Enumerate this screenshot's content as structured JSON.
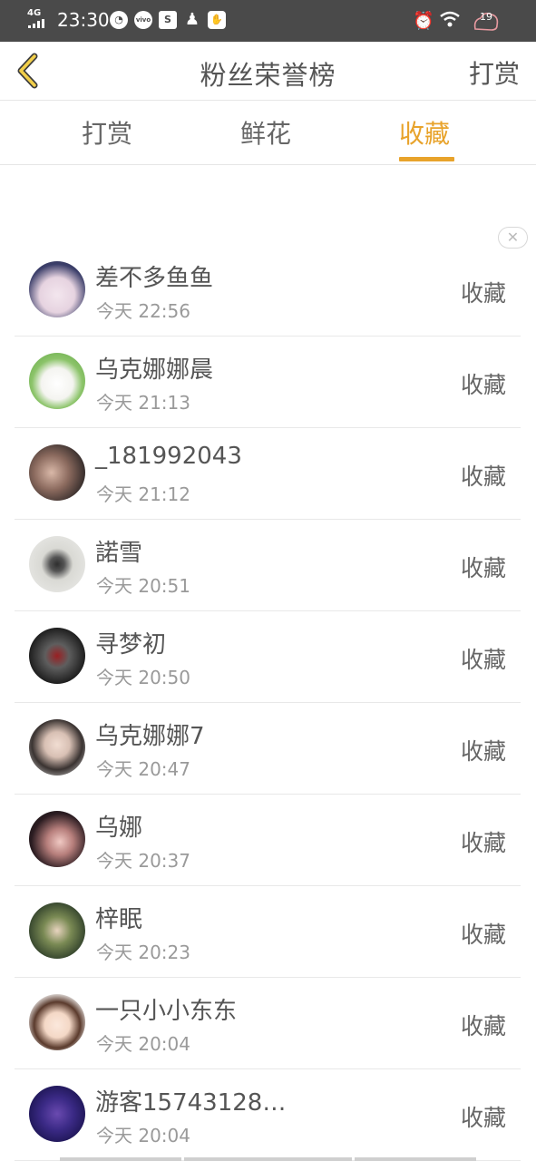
{
  "status_bar": {
    "network": "4G",
    "time": "23:30",
    "battery": "19"
  },
  "header": {
    "title": "粉丝荣誉榜",
    "right_action": "打赏"
  },
  "tabs": [
    {
      "label": "打赏",
      "active": false
    },
    {
      "label": "鲜花",
      "active": false
    },
    {
      "label": "收藏",
      "active": true
    }
  ],
  "colors": {
    "accent": "#e8a32b",
    "status_bar": "#4a4a4a"
  },
  "fans": [
    {
      "name": "差不多鱼鱼",
      "time": "今天 22:56",
      "action": "收藏"
    },
    {
      "name": "乌克娜娜晨",
      "time": "今天 21:13",
      "action": "收藏"
    },
    {
      "name": "_181992043",
      "time": "今天 21:12",
      "action": "收藏"
    },
    {
      "name": "諾雪",
      "time": "今天 20:51",
      "action": "收藏"
    },
    {
      "name": "寻梦初",
      "time": "今天 20:50",
      "action": "收藏"
    },
    {
      "name": "乌克娜娜7",
      "time": "今天 20:47",
      "action": "收藏"
    },
    {
      "name": "乌娜",
      "time": "今天 20:37",
      "action": "收藏"
    },
    {
      "name": "梓眠",
      "time": "今天 20:23",
      "action": "收藏"
    },
    {
      "name": "一只小小东东",
      "time": "今天 20:04",
      "action": "收藏"
    },
    {
      "name": "游客15743128…",
      "time": "今天 20:04",
      "action": "收藏"
    }
  ]
}
